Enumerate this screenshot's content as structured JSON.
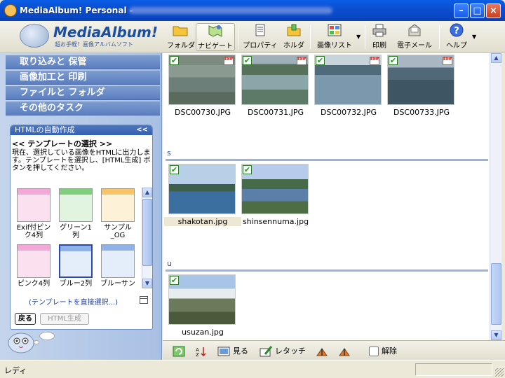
{
  "window": {
    "title_prefix": "MediaAlbum! Personal -",
    "minimize_glyph": "–",
    "maximize_glyph": "□",
    "close_glyph": "×"
  },
  "logo": {
    "title": "MediaAlbum!",
    "subtitle": "超お手軽！画像アルバムソフト"
  },
  "toolbar": {
    "items": [
      {
        "label": "フォルダ",
        "icon": "folder-icon"
      },
      {
        "label": "ナビゲート",
        "icon": "navigate-icon"
      },
      {
        "label": "プロパティ",
        "icon": "properties-icon"
      },
      {
        "label": "ホルダ",
        "icon": "holder-icon"
      },
      {
        "label": "画像リスト",
        "icon": "image-list-icon"
      },
      {
        "label": "印刷",
        "icon": "printer-icon"
      },
      {
        "label": "電子メール",
        "icon": "email-icon"
      },
      {
        "label": "ヘルプ",
        "icon": "help-icon"
      }
    ],
    "dropdown_glyph": "▼"
  },
  "sidebar": {
    "tasks": [
      "取り込みと 保管",
      "画像加工と 印刷",
      "ファイルと フォルダ",
      "その他のタスク"
    ],
    "html_panel": {
      "header": "HTMLの自動作成",
      "collapse_glyph": "<<",
      "section_title": "<< テンプレートの選択 >>",
      "description": "現在、選択している画像をHTMLに出力します。テンプレートを選択し、[HTML生成] ボタンを押してください。",
      "templates": [
        {
          "label": "Exif付ピンク4列",
          "color": "#f4a8d8"
        },
        {
          "label": "グリーン1列",
          "color": "#7fcf7f"
        },
        {
          "label": "サンプル_OG",
          "color": "#f7c46a"
        },
        {
          "label": "ピンク4列",
          "color": "#f4a8d8"
        },
        {
          "label": "ブルー2列",
          "color": "#8fb3e8"
        },
        {
          "label": "ブルーサン",
          "color": "#8fb3e8"
        }
      ],
      "direct_select": "(テンプレートを直接選択...)",
      "back_button": "戻る",
      "generate_button": "HTML生成"
    }
  },
  "content": {
    "groups": [
      {
        "label": "",
        "photos": [
          {
            "name": "DSC00730.JPG",
            "checked": true,
            "exif": true
          },
          {
            "name": "DSC00731.JPG",
            "checked": true,
            "exif": true
          },
          {
            "name": "DSC00732.JPG",
            "checked": true,
            "exif": true
          },
          {
            "name": "DSC00733.JPG",
            "checked": true,
            "exif": true
          }
        ]
      },
      {
        "label": "s",
        "photos": [
          {
            "name": "shakotan.jpg",
            "checked": true,
            "exif": false,
            "selected": true
          },
          {
            "name": "shinsennuma.jpg",
            "checked": true,
            "exif": false
          }
        ]
      },
      {
        "label": "u",
        "photos": [
          {
            "name": "usuzan.jpg",
            "checked": true,
            "exif": false
          }
        ]
      }
    ],
    "check_glyph": "✔",
    "exif_label": "EXIF"
  },
  "bottombar": {
    "items": [
      {
        "label": "",
        "icon": "refresh-icon"
      },
      {
        "label": "",
        "icon": "sort-icon"
      },
      {
        "label": "見る",
        "icon": "view-icon"
      },
      {
        "label": "レタッチ",
        "icon": "retouch-icon"
      },
      {
        "label": "",
        "icon": "rotate-left-icon"
      },
      {
        "label": "",
        "icon": "rotate-right-icon"
      },
      {
        "label": "解除",
        "icon": "deselect-icon"
      }
    ]
  },
  "status": {
    "text": "レディ"
  },
  "colors": {
    "titlebar": "#0b4fd1",
    "sidebar_task": "#5b7ec0",
    "group_line": "#9bb4dc"
  }
}
